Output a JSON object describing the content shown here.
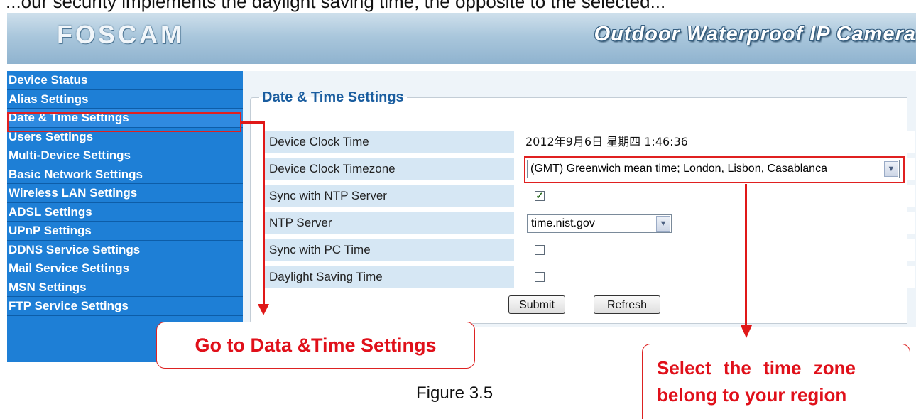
{
  "header": {
    "top_fragment": "...our security implements the daylight saving time, the opposite to the selected...",
    "logo": "FOSCAM",
    "product_title": "Outdoor Waterproof IP Camera"
  },
  "sidebar": {
    "items": [
      {
        "label": "Device Status"
      },
      {
        "label": "Alias Settings"
      },
      {
        "label": "Date & Time Settings"
      },
      {
        "label": "Users Settings"
      },
      {
        "label": "Multi-Device Settings"
      },
      {
        "label": "Basic Network Settings"
      },
      {
        "label": "Wireless LAN Settings"
      },
      {
        "label": "ADSL Settings"
      },
      {
        "label": "UPnP Settings"
      },
      {
        "label": "DDNS Service Settings"
      },
      {
        "label": "Mail Service Settings"
      },
      {
        "label": "MSN Settings"
      },
      {
        "label": "FTP Service Settings"
      }
    ],
    "active_index": 2
  },
  "panel": {
    "title": "Date & Time Settings",
    "rows": {
      "clock_label": "Device Clock Time",
      "clock_value": "2012年9月6日 星期四 1:46:36",
      "timezone_label": "Device Clock Timezone",
      "timezone_value": "(GMT) Greenwich mean time; London, Lisbon, Casablanca",
      "ntp_sync_label": "Sync with NTP Server",
      "ntp_sync_checked": true,
      "ntp_server_label": "NTP Server",
      "ntp_server_value": "time.nist.gov",
      "pc_sync_label": "Sync with PC Time",
      "pc_sync_checked": false,
      "dst_label": "Daylight Saving Time",
      "dst_checked": false
    },
    "submit_label": "Submit",
    "refresh_label": "Refresh"
  },
  "annotations": {
    "left_note": "Go to Data &Time Settings",
    "right_note_line1": "Select the time zone",
    "right_note_line2": "belong to your region"
  },
  "caption": "Figure 3.5",
  "colors": {
    "sidebar_bg": "#1e7fd6",
    "label_cell_bg": "#d6e7f4",
    "annotation_red": "#e0101a",
    "panel_title": "#1a5d9f"
  },
  "icons": {
    "dropdown": "chevron-down-icon",
    "checkbox_checked": "checkmark-icon"
  }
}
